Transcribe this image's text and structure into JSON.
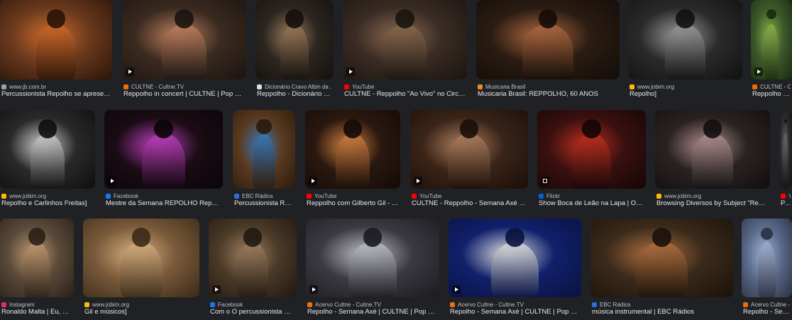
{
  "results": [
    {
      "source": "www.jb.com.br",
      "title": "Percussionista Repolho se apresen...",
      "badge": "none",
      "favicon": "#9aa0a6",
      "tone": [
        "#6b3a1e",
        "#d06a2a",
        "#2a1408"
      ]
    },
    {
      "source": "CULTNE - Cultne.TV",
      "title": "Reppolho in concert | CULTNE | Pop & ...",
      "badge": "video",
      "favicon": "#e8710a",
      "tone": [
        "#3a2a20",
        "#c08060",
        "#1a1410"
      ]
    },
    {
      "source": "Dicionário Cravo Albin da ...",
      "title": "Reppolho - Dicionário C...",
      "badge": "none",
      "favicon": "#dadce0",
      "tone": [
        "#2c2620",
        "#9a7a5a",
        "#14100c"
      ]
    },
    {
      "source": "YouTube",
      "title": "CULTNE - Reppolho \"Ao Vivo\" no Circo ...",
      "badge": "video",
      "favicon": "#ff0000",
      "tone": [
        "#3a2c24",
        "#8a6a50",
        "#1a1410"
      ]
    },
    {
      "source": "Musicaria Brasil",
      "title": "Musicaria Brasil: REPPOLHO, 60 ANOS",
      "badge": "none",
      "favicon": "#f28b20",
      "tone": [
        "#2a1c12",
        "#b06a40",
        "#120c08"
      ]
    },
    {
      "source": "www.jobim.org",
      "title": "Repolho]",
      "badge": "none",
      "favicon": "#fbbc04",
      "tone": [
        "#2a2a2a",
        "#9a9a9a",
        "#111111"
      ]
    },
    {
      "source": "CULTNE - Cultne.TV",
      "title": "Reppolho in c",
      "badge": "video",
      "favicon": "#e8710a",
      "tone": [
        "#3c5a2a",
        "#8ab04a",
        "#1a2a10"
      ]
    },
    {
      "source": "www.jobim.org",
      "title": "Repolho e Carlinhos Freitas]",
      "badge": "none",
      "favicon": "#fbbc04",
      "tone": [
        "#2a2a2a",
        "#d0d0d0",
        "#0e0e0e"
      ]
    },
    {
      "source": "Facebook",
      "title": "Mestre da Semana REPOLHO Reppol...",
      "badge": "video",
      "favicon": "#1877f2",
      "tone": [
        "#1a0c14",
        "#c040c0",
        "#0a0508"
      ]
    },
    {
      "source": "EBC Rádios",
      "title": "Percussionista Re...",
      "badge": "none",
      "favicon": "#2f6de1",
      "tone": [
        "#5a3a20",
        "#3a78b8",
        "#2a1a0c"
      ]
    },
    {
      "source": "YouTube",
      "title": "Reppolho com Gilberto Gil - to...",
      "badge": "video",
      "favicon": "#ff0000",
      "tone": [
        "#2a1810",
        "#d08040",
        "#140a06"
      ]
    },
    {
      "source": "YouTube",
      "title": "CULTNE - Reppolho - Semana Axé - Y...",
      "badge": "video",
      "favicon": "#ff0000",
      "tone": [
        "#3a2418",
        "#b08060",
        "#1a0e08"
      ]
    },
    {
      "source": "Flickr",
      "title": "Show Boca de Leão na Lapa | O G...",
      "badge": "photo",
      "favicon": "#0063dc",
      "tone": [
        "#3a1010",
        "#c03020",
        "#140606"
      ]
    },
    {
      "source": "www.jobim.org",
      "title": "Browsing Diversos by Subject \"Repol...",
      "badge": "none",
      "favicon": "#fbbc04",
      "tone": [
        "#2a2222",
        "#b09090",
        "#120e0e"
      ]
    },
    {
      "source": "Y",
      "title": "Pra",
      "badge": "none",
      "favicon": "#ff0000",
      "tone": [
        "#2a2a2a",
        "#6a6a6a",
        "#111111"
      ]
    },
    {
      "source": "Instagram",
      "title": "Ronaldo Malta | Eu, R...",
      "badge": "none",
      "favicon": "#e1306c",
      "tone": [
        "#5a4a3a",
        "#c09a70",
        "#2a2018"
      ]
    },
    {
      "source": "www.jobim.org",
      "title": "Gil e músicos]",
      "badge": "none",
      "favicon": "#fbbc04",
      "tone": [
        "#7a5a3a",
        "#d8b080",
        "#3a2a18"
      ]
    },
    {
      "source": "Facebook",
      "title": "Com o O percussionista Re...",
      "badge": "video",
      "favicon": "#1877f2",
      "tone": [
        "#4a3a28",
        "#a08060",
        "#201810"
      ]
    },
    {
      "source": "Acervo Cultne - Cultne.TV",
      "title": "Repolho - Semana Axé | CULTNE | Pop & M...",
      "badge": "video",
      "favicon": "#e8710a",
      "tone": [
        "#3a3a40",
        "#c0c0c8",
        "#1a1a20"
      ]
    },
    {
      "source": "Acervo Cultne - Cultne.TV",
      "title": "Repolho - Semana Axé | CULTNE | Pop & M...",
      "badge": "video",
      "favicon": "#e8710a",
      "tone": [
        "#10206a",
        "#e0e0e0",
        "#0a1240"
      ]
    },
    {
      "source": "EBC Rádios",
      "title": "música instrumental | EBC Rádios",
      "badge": "none",
      "favicon": "#2f6de1",
      "tone": [
        "#3a2a1a",
        "#b07040",
        "#1a120a"
      ]
    },
    {
      "source": "Acervo Cultne - C",
      "title": "Repolho - Seman",
      "badge": "none",
      "favicon": "#e8710a",
      "tone": [
        "#5a6a8a",
        "#a0b0d0",
        "#2a3040"
      ]
    }
  ]
}
